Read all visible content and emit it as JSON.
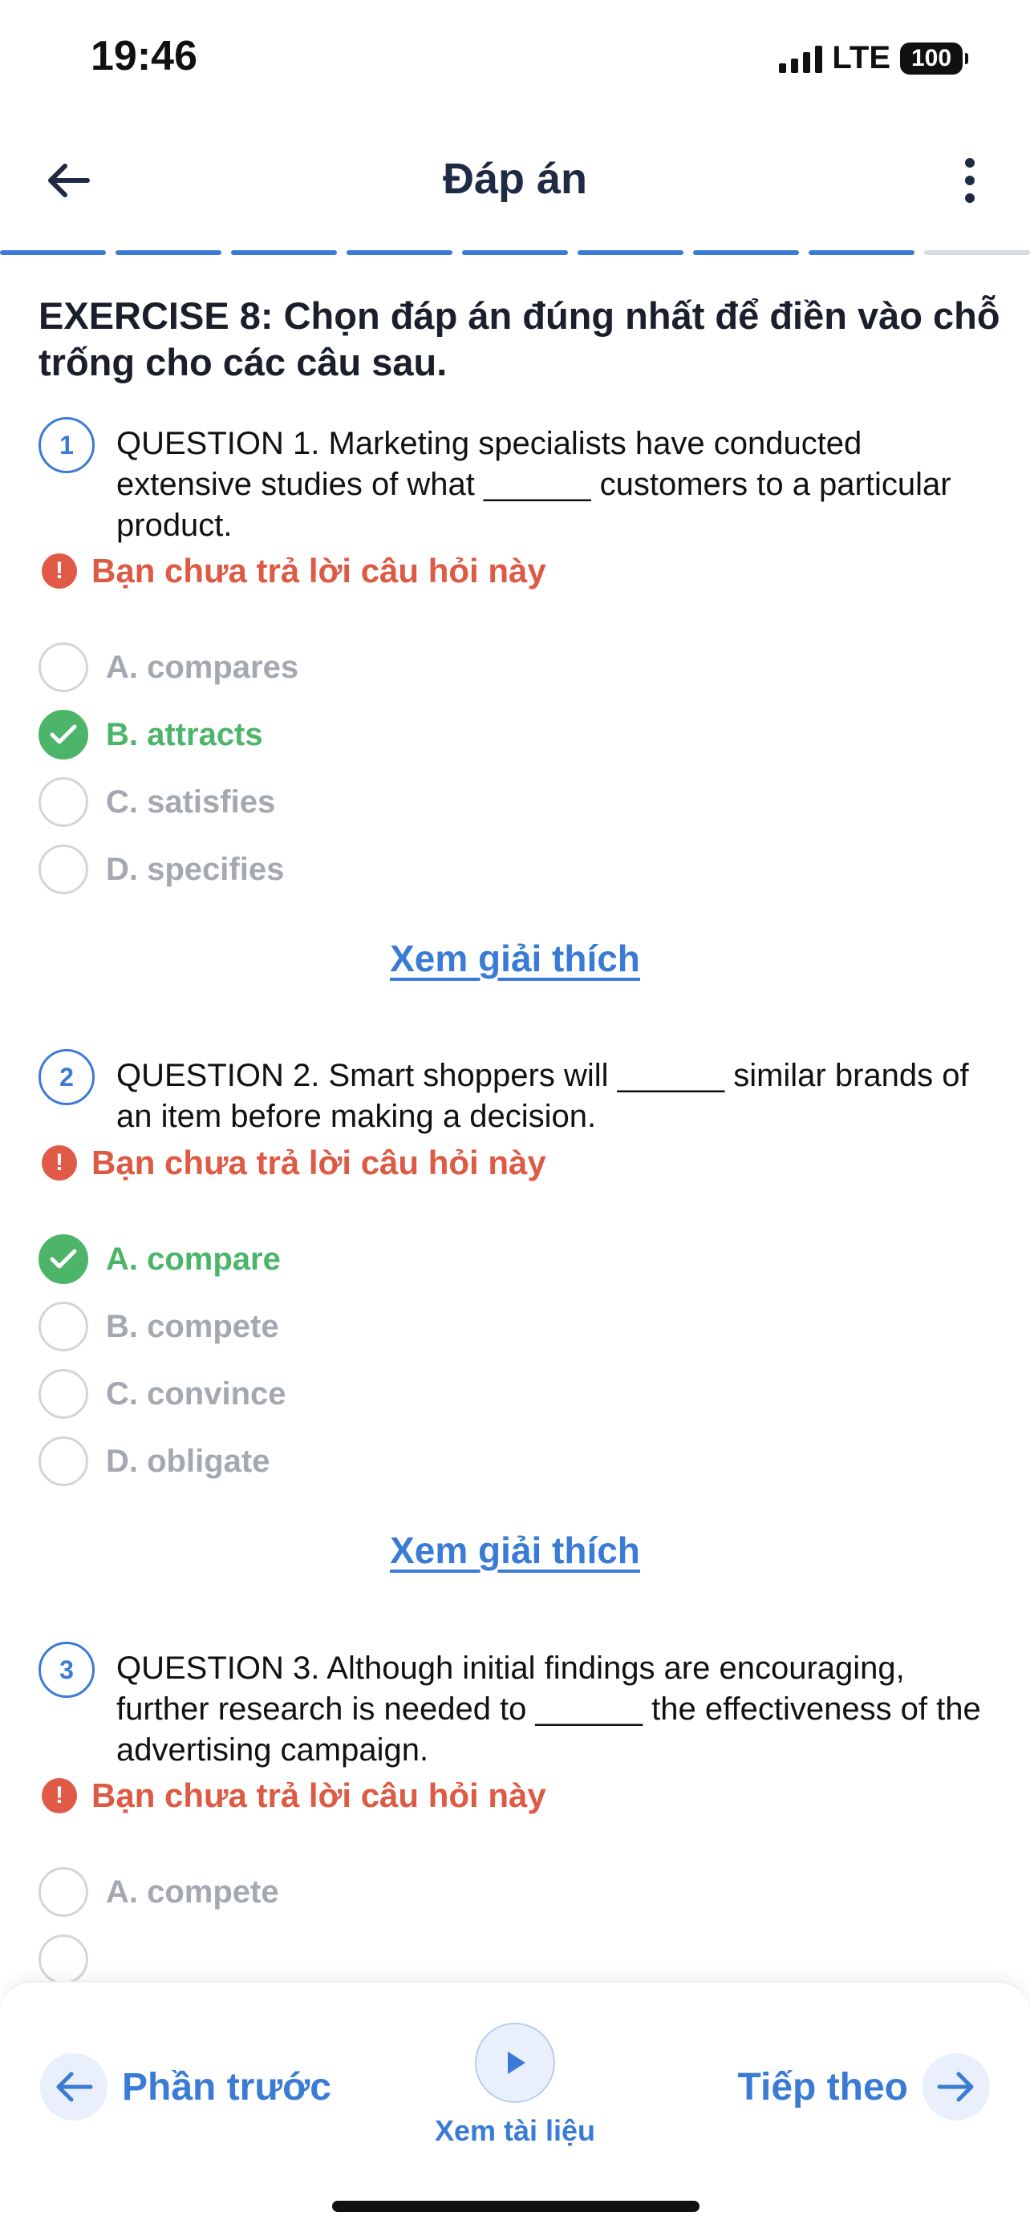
{
  "status": {
    "time": "19:46",
    "network": "LTE",
    "battery": "100"
  },
  "header": {
    "title": "Đáp án",
    "progress_total": 9,
    "progress_done": 8
  },
  "exercise_title": "EXERCISE 8: Chọn đáp án đúng nhất để điền vào chỗ trống cho các câu sau.",
  "warning_text": "Bạn chưa trả lời câu hỏi này",
  "explain_label": "Xem giải thích",
  "questions": [
    {
      "number": "1",
      "text": "QUESTION 1. Marketing specialists have conducted extensive studies of what ______ customers to a particular product.",
      "options": [
        {
          "label": "A. compares",
          "correct": false
        },
        {
          "label": "B. attracts",
          "correct": true
        },
        {
          "label": "C. satisfies",
          "correct": false
        },
        {
          "label": "D. specifies",
          "correct": false
        }
      ]
    },
    {
      "number": "2",
      "text": "QUESTION 2. Smart shoppers will ______ similar brands of an item before making a decision.",
      "options": [
        {
          "label": "A. compare",
          "correct": true
        },
        {
          "label": "B. compete",
          "correct": false
        },
        {
          "label": "C. convince",
          "correct": false
        },
        {
          "label": "D. obligate",
          "correct": false
        }
      ]
    },
    {
      "number": "3",
      "text": "QUESTION 3. Although initial findings are encouraging, further research is needed to ______ the effectiveness of the advertising campaign.",
      "options": [
        {
          "label": "A. compete",
          "correct": false
        }
      ]
    }
  ],
  "bottom_bar": {
    "prev_label": "Phần trước",
    "next_label": "Tiếp theo",
    "materials_label": "Xem tài liệu"
  },
  "colors": {
    "accent": "#3a7bd5",
    "correct": "#4cb56a",
    "warning": "#dd5a44",
    "muted": "#a4a8b0"
  },
  "icons": [
    "back-arrow-icon",
    "more-vertical-icon",
    "exclamation-icon",
    "check-icon",
    "arrow-left-icon",
    "arrow-right-icon",
    "play-icon",
    "signal-icon",
    "battery-icon"
  ]
}
